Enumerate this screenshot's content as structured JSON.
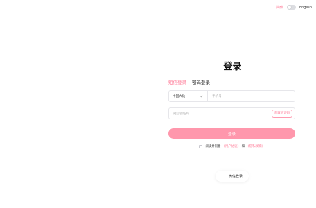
{
  "header": {
    "lang_cn": "简体",
    "lang_en": "English"
  },
  "login": {
    "title": "登录",
    "tabs": [
      {
        "label": "短信登录",
        "active": true
      },
      {
        "label": "密码登录",
        "active": false
      }
    ],
    "region": "中国大陆",
    "phone_placeholder": "手机号",
    "code_placeholder": "短信验证码",
    "get_code_label": "获取验证码",
    "submit_label": "登录",
    "agreement": {
      "prefix": "阅读并同意",
      "user_agreement": "《用户协议》",
      "and": "和",
      "privacy_policy": "《隐私政策》"
    },
    "wechat_label": "微信登录"
  },
  "colors": {
    "accent": "#ff7c98",
    "button": "#ff97ac"
  }
}
